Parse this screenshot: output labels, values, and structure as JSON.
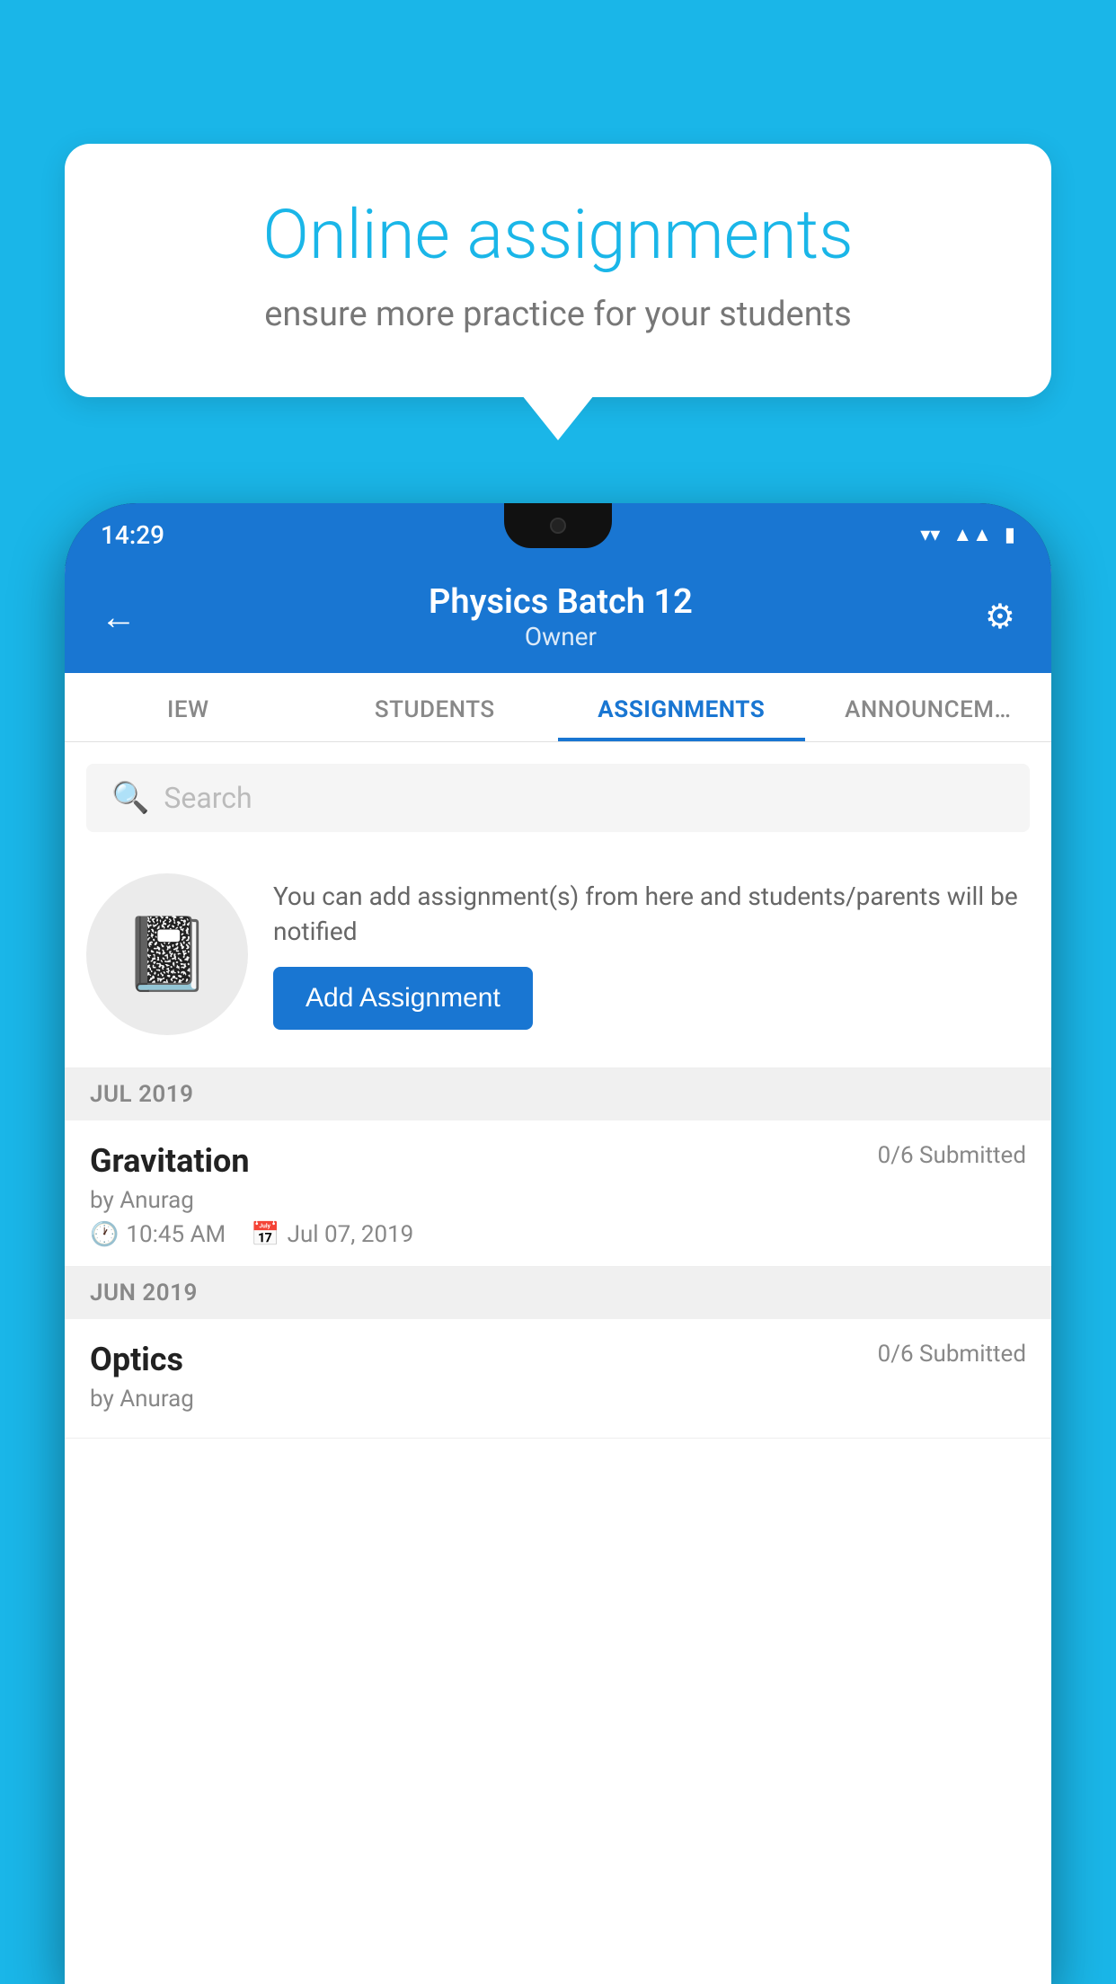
{
  "background_color": "#1ab6e8",
  "speech_bubble": {
    "title": "Online assignments",
    "subtitle": "ensure more practice for your students"
  },
  "phone": {
    "status_bar": {
      "time": "14:29",
      "icons": [
        "wifi",
        "signal",
        "battery"
      ]
    },
    "header": {
      "title": "Physics Batch 12",
      "subtitle": "Owner",
      "back_label": "←",
      "settings_label": "⚙"
    },
    "tabs": [
      {
        "label": "IEW",
        "active": false
      },
      {
        "label": "STUDENTS",
        "active": false
      },
      {
        "label": "ASSIGNMENTS",
        "active": true
      },
      {
        "label": "ANNOUNCEM…",
        "active": false
      }
    ],
    "search": {
      "placeholder": "Search"
    },
    "prompt": {
      "text": "You can add assignment(s) from here and students/parents will be notified",
      "button_label": "Add Assignment"
    },
    "sections": [
      {
        "label": "JUL 2019",
        "assignments": [
          {
            "name": "Gravitation",
            "submitted": "0/6 Submitted",
            "author": "by Anurag",
            "time": "10:45 AM",
            "date": "Jul 07, 2019"
          }
        ]
      },
      {
        "label": "JUN 2019",
        "assignments": [
          {
            "name": "Optics",
            "submitted": "0/6 Submitted",
            "author": "by Anurag",
            "time": "",
            "date": ""
          }
        ]
      }
    ]
  }
}
